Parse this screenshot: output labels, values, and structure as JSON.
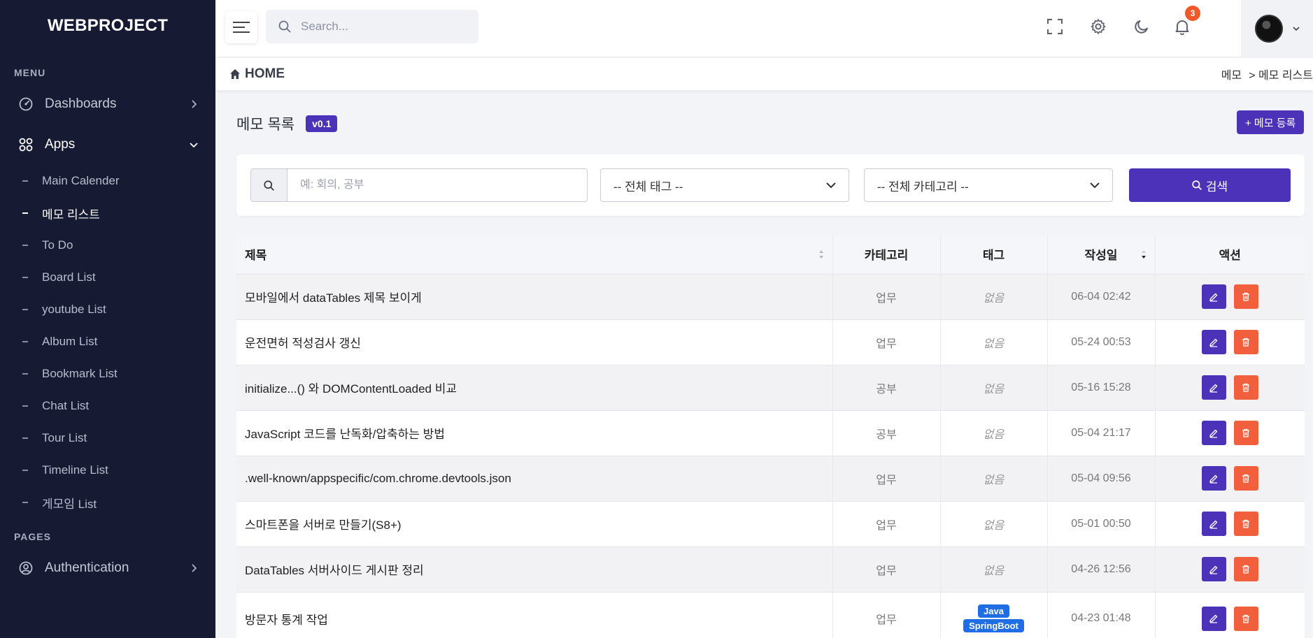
{
  "brand": "WEBPROJECT",
  "sidebar": {
    "menu_title": "MENU",
    "dashboards": "Dashboards",
    "apps": "Apps",
    "sub_items": [
      "Main Calender",
      "메모 리스트",
      "To Do",
      "Board List",
      "youtube List",
      "Album List",
      "Bookmark List",
      "Chat List",
      "Tour List",
      "Timeline List",
      "게모임 List"
    ],
    "pages_title": "PAGES",
    "authentication": "Authentication"
  },
  "header": {
    "search_placeholder": "Search...",
    "notification_count": "3"
  },
  "breadcrumb": {
    "home": "HOME",
    "items": [
      "메모",
      "> 메모 리스트"
    ]
  },
  "page": {
    "title": "메모 목록",
    "version": "v0.1",
    "add_button": "+ 메모 등록"
  },
  "filter": {
    "keyword_placeholder": "예: 회의, 공부",
    "tag_select": "-- 전체 태그 --",
    "category_select": "-- 전체 카테고리 --",
    "search_button": "검색"
  },
  "table": {
    "headers": [
      "제목",
      "카테고리",
      "태그",
      "작성일",
      "액션"
    ],
    "rows": [
      {
        "title": "모바일에서 dataTables 제목 보이게",
        "category": "업무",
        "tag": "없음",
        "date": "06-04 02:42"
      },
      {
        "title": "운전면허 적성검사 갱신",
        "category": "업무",
        "tag": "없음",
        "date": "05-24 00:53"
      },
      {
        "title": "initialize...() 와 DOMContentLoaded 비교",
        "category": "공부",
        "tag": "없음",
        "date": "05-16 15:28"
      },
      {
        "title": "JavaScript 코드를 난독화/압축하는 방법",
        "category": "공부",
        "tag": "없음",
        "date": "05-04 21:17"
      },
      {
        "title": ".well-known/appspecific/com.chrome.devtools.json",
        "category": "업무",
        "tag": "없음",
        "date": "05-04 09:56"
      },
      {
        "title": "스마트폰을 서버로 만들기(S8+)",
        "category": "업무",
        "tag": "없음",
        "date": "05-01 00:50"
      },
      {
        "title": "DataTables 서버사이드 게시판 정리",
        "category": "업무",
        "tag": "없음",
        "date": "04-26 12:56"
      },
      {
        "title": "방문자 통계 작업",
        "category": "업무",
        "tags": [
          "Java",
          "SpringBoot"
        ],
        "date": "04-23 01:48"
      }
    ]
  },
  "colors": {
    "sidebar_bg": "#171a33",
    "primary": "#4b32b8",
    "danger": "#f15f3c",
    "tag_blue": "#1f6ee6",
    "badge": "#f1592a"
  }
}
